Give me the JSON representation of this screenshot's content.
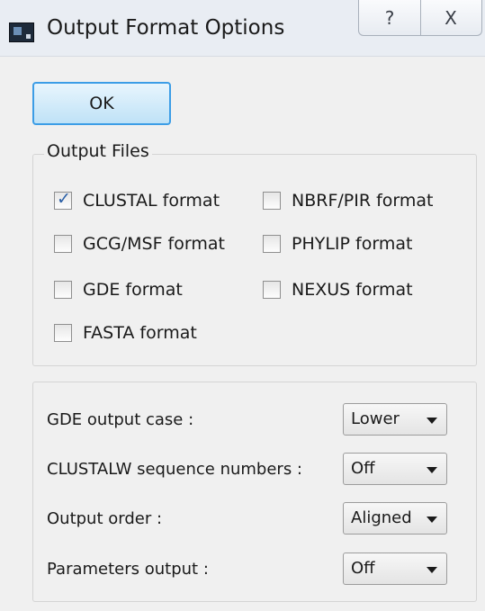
{
  "window": {
    "title": "Output Format Options",
    "help_icon": "question-mark-icon",
    "close_icon": "close-icon",
    "help_glyph": "?",
    "close_glyph": "X"
  },
  "ok_label": "OK",
  "output_files": {
    "title": "Output Files",
    "checkboxes": [
      {
        "label": "CLUSTAL format",
        "checked": true
      },
      {
        "label": "NBRF/PIR format",
        "checked": false
      },
      {
        "label": "GCG/MSF format",
        "checked": false
      },
      {
        "label": "PHYLIP format",
        "checked": false
      },
      {
        "label": "GDE format",
        "checked": false
      },
      {
        "label": "NEXUS format",
        "checked": false
      },
      {
        "label": "FASTA format",
        "checked": false
      }
    ]
  },
  "settings": [
    {
      "label": "GDE output case :",
      "value": "Lower"
    },
    {
      "label": "CLUSTALW sequence numbers :",
      "value": "Off"
    },
    {
      "label": "Output order :",
      "value": "Aligned"
    },
    {
      "label": "Parameters output :",
      "value": "Off"
    }
  ],
  "check_glyph": "✓"
}
